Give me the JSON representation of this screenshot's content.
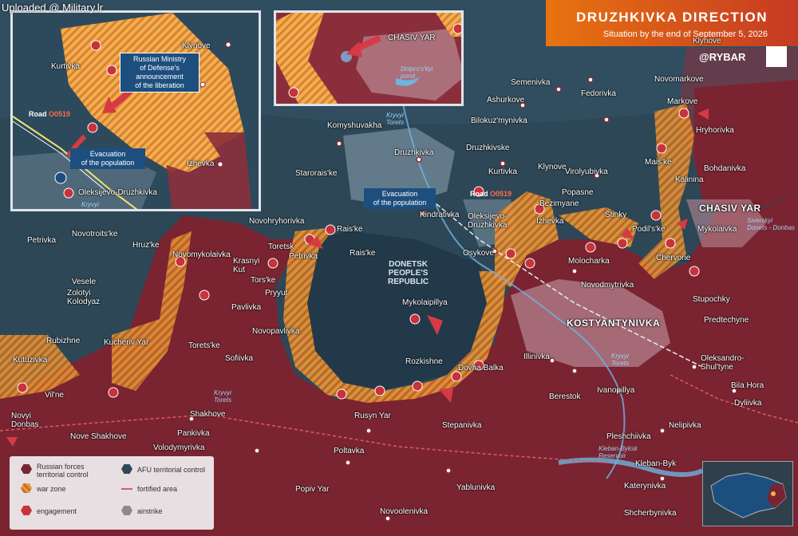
{
  "watermark": "Uploaded @ Military.lr",
  "header": {
    "title": "Druzhkivka direction",
    "subtitle": "Situation by the end of September 5, 2026"
  },
  "brand": "@RYBAR",
  "colors": {
    "russian_control": "#7d2530",
    "afu_control": "#2e4858",
    "war_zone": "#e8a23a",
    "engagement": "#c8323a",
    "fortified_line": "#e05a60",
    "header_gradient_start": "#e8730f",
    "header_gradient_end": "#c53a23",
    "callout_blue": "#1d4f7e"
  },
  "legend": {
    "russian": "Russian forces\nterritorial control",
    "afu": "AFU territorial control",
    "war_zone": "war zone",
    "fortified": "fortified area",
    "engagement": "engagement",
    "airstrike": "airstrike"
  },
  "inset_left": {
    "settlements": [
      "Klynove",
      "Kurtivka",
      "Izhevka",
      "Oleksijevo-Druzhkivka"
    ],
    "callout_mod": "Russian Ministry\nof Defense's\nannouncement\nof the liberation",
    "callout_evac": "Evacuation\nof the population",
    "road_label": "Road",
    "road_code": "O0519",
    "river": "Kryvyi\nTorets"
  },
  "inset_top": {
    "city": "CHASIV YAR",
    "pond": "Dnipro's'kyi\npond"
  },
  "main": {
    "region": "DONETSK\nPEOPLE'S\nREPUBLIC",
    "callout_evac": "Evacuation\nof the population",
    "road_label": "Road",
    "road_code": "O0519",
    "rivers": [
      "Kryvyi\nTorets",
      "Kryvyi\nTorets",
      "Kryvyi\nTorets",
      "Siverskyi\nDonets - Donbas",
      "Kleban-Byksk\nReservoir"
    ],
    "settlements": [
      "Klynove",
      "Semenivka",
      "Novomarkove",
      "Ashurkove",
      "Fedorivka",
      "Markove",
      "Bilokuz'mynivka",
      "Hryhorivka",
      "Komyshuvakha",
      "Druzhkivske",
      "Druzhkivka",
      "Starorais'ke",
      "Kurtivka",
      "Klynove",
      "Virolyubivka",
      "Mais'ke",
      "Bohdanivka",
      "Kalinina",
      "Popasne",
      "Bezimyane",
      "Izhevka",
      "Stinky",
      "CHASIV YAR",
      "Kindrativka",
      "Oleksijevo-\nDruzhkivka",
      "Podil's'ke",
      "Mykolaivka",
      "Novohryhorivka",
      "Rais'ke",
      "Rais'ke",
      "Novotroits'ke",
      "Petrivka",
      "Toretsk",
      "Petrivka",
      "Novomykolaivka",
      "Krasnyi\nKut",
      "Osykove",
      "Molocharka",
      "Chervone",
      "Tors'ke",
      "Novodmytrivka",
      "Stupochky",
      "Hruz'ke",
      "Vesele",
      "Zolotyi\nKolodyaz",
      "Pryyut",
      "Pavlivka",
      "Mykolaipillya",
      "KOSTYANTYNIVKA",
      "Predtechyne",
      "Novopavlivka",
      "Rubizhne",
      "Kucheriv Yar",
      "Torets'ke",
      "Sofiivka",
      "Illinivka",
      "Rozkishne",
      "Dovha Balka",
      "Oleksandro-\nShul'tyne",
      "Kutuzivka",
      "Bila Hora",
      "Vil'ne",
      "Dyliivka",
      "Berestok",
      "Ivanopillya",
      "Shakhove",
      "Novyi\nDonbas",
      "Rusyn Yar",
      "Nelipivka",
      "Nove Shakhove",
      "Pankivka",
      "Stepanivka",
      "Pleshchiivka",
      "Volodymyrivka",
      "Poltavka",
      "Kleban-Byk",
      "Popiv Yar",
      "Yablunivka",
      "Katerynivka",
      "Novoolenivka",
      "Shcherbynivka"
    ]
  }
}
